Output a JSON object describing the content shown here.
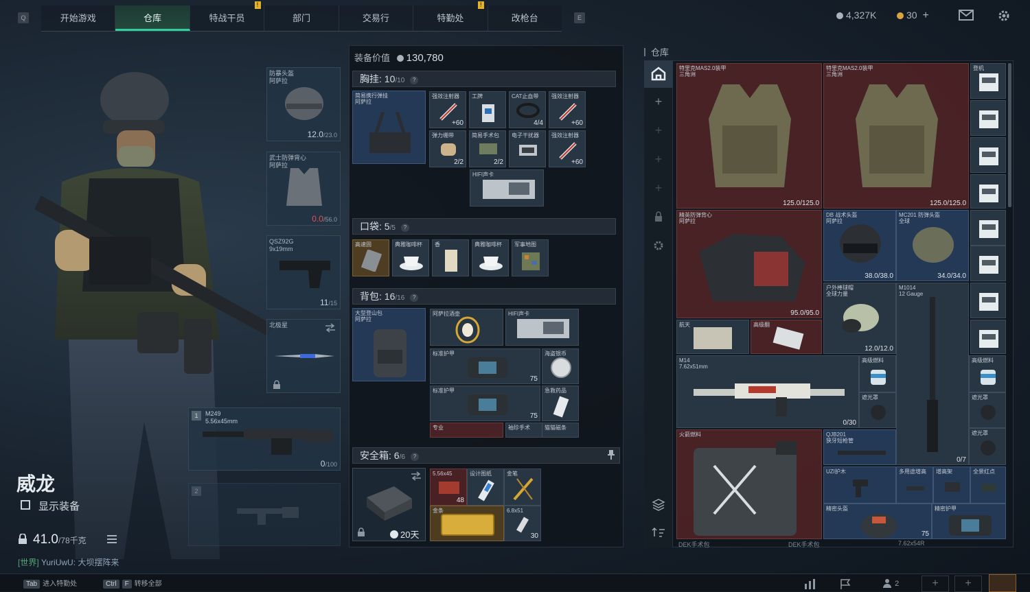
{
  "nav": {
    "left_key": "Q",
    "right_key": "E",
    "tabs": [
      {
        "label": "开始游戏",
        "warn": false
      },
      {
        "label": "仓库",
        "warn": false,
        "active": true
      },
      {
        "label": "特战干员",
        "warn": true
      },
      {
        "label": "部门",
        "warn": false
      },
      {
        "label": "交易行",
        "warn": false
      },
      {
        "label": "特勤处",
        "warn": true
      },
      {
        "label": "改枪台",
        "warn": false
      }
    ],
    "warn_glyph": "!"
  },
  "header_right": {
    "currency_main": "4,327K",
    "currency_secondary": "30",
    "add": "+",
    "coin_colors": {
      "main": "#aab2bb",
      "secondary": "#d8a441"
    }
  },
  "operator": {
    "name": "威龙",
    "show_equipment": "显示装备",
    "weight": "41.0",
    "weight_max": "/78千克",
    "chat_channel": "[世界]",
    "chat_text": "YuriUwU: 大坝摆阵来"
  },
  "equip_slots": {
    "helmet": {
      "name": "防暴头盔",
      "sub": "阿萨拉",
      "value": "12.0",
      "max": "/23.0"
    },
    "armor": {
      "name": "武士防弹背心",
      "sub": "阿萨拉",
      "value": "0.0",
      "max": "/56.0"
    },
    "pistol": {
      "name": "QSZ92G",
      "sub": "9x19mm",
      "value": "11",
      "max": "/15"
    },
    "melee": {
      "name": "北极星"
    },
    "primary1": {
      "index": "1",
      "name": "M249",
      "sub": "5.56x45mm",
      "value": "0",
      "max": "/100"
    },
    "primary2": {
      "index": "2"
    }
  },
  "loadout": {
    "value_label": "装备价值",
    "value": "130,780",
    "chest": {
      "label": "胸挂:",
      "count": "10",
      "max": "/10"
    },
    "pocket": {
      "label": "口袋:",
      "count": "5",
      "max": "/5"
    },
    "backpack": {
      "label": "背包:",
      "count": "16",
      "max": "/16"
    },
    "safebox": {
      "label": "安全箱:",
      "count": "6",
      "max": "/6",
      "timer": "20天"
    },
    "help": "?"
  },
  "chest_items": [
    {
      "t": "简易携行弹挂",
      "s": "阿萨拉"
    },
    {
      "t": "强效注射器",
      "n": "+60"
    },
    {
      "t": "工牌"
    },
    {
      "t": "CAT止血带",
      "n": "4/4"
    },
    {
      "t": "强效注射器",
      "n": "+60"
    },
    {
      "t": "弹力绷带",
      "n": "2/2"
    },
    {
      "t": "简易手术包",
      "n": "2/2"
    },
    {
      "t": "电子干扰器"
    },
    {
      "t": "强效注射器",
      "n": "+60"
    },
    {
      "t": "HIFI声卡"
    }
  ],
  "pocket_items": [
    {
      "t": "高速固"
    },
    {
      "t": "典雅咖啡杯"
    },
    {
      "t": "香"
    },
    {
      "t": "典雅咖啡杯"
    },
    {
      "t": "军事地图"
    }
  ],
  "backpack_items": [
    {
      "t": "大型登山包",
      "s": "阿萨拉"
    },
    {
      "t": "阿萨拉酒壶"
    },
    {
      "t": "HIFI声卡"
    },
    {
      "t": "标准护甲",
      "n": "75"
    },
    {
      "t": "海盗银币"
    },
    {
      "t": "标准护甲",
      "n": "75"
    },
    {
      "t": "急救药品"
    },
    {
      "t": "专业"
    },
    {
      "t": "袖珍手术"
    },
    {
      "t": "猫猫磁条"
    }
  ],
  "safebox_items": [
    {
      "t": "5.56x45",
      "n": "48"
    },
    {
      "t": "设计图纸"
    },
    {
      "t": "金笔"
    },
    {
      "t": "金条"
    },
    {
      "t": "6.8x51",
      "n": "30"
    }
  ],
  "stash": {
    "title": "仓库",
    "items": [
      {
        "t": "特里克MAS2.0装甲",
        "s": "三角洲",
        "n": "125.0/125.0"
      },
      {
        "t": "特里克MAS2.0装甲",
        "s": "三角洲",
        "n": "125.0/125.0"
      },
      {
        "t": "精英防弹背心",
        "s": "阿萨拉",
        "n": "95.0/95.0"
      },
      {
        "t": "DB 战术头盔",
        "s": "阿萨拉",
        "n": "38.0/38.0"
      },
      {
        "t": "MC201 防弹头盔",
        "s": "全球",
        "n": "34.0/34.0"
      },
      {
        "t": "户外棒球帽",
        "s": "全球力量",
        "n": "12.0/12.0"
      },
      {
        "t": "M1014",
        "s": "12 Gauge",
        "n": "0/7"
      },
      {
        "t": "航天"
      },
      {
        "t": "高级翻"
      },
      {
        "t": "M14",
        "s": "7.62x51mm",
        "n": "0/30"
      },
      {
        "t": "高级燃料"
      },
      {
        "t": "遮光罩"
      },
      {
        "t": "高级燃料"
      },
      {
        "t": "遮光罩"
      },
      {
        "t": "遮光罩"
      },
      {
        "t": "火箭燃料"
      },
      {
        "t": "QJB201",
        "s": "狭牙短枪管"
      },
      {
        "t": "UZI护木"
      },
      {
        "t": "多用途增高"
      },
      {
        "t": "增高架"
      },
      {
        "t": "全景红点"
      },
      {
        "t": "精密头盔"
      },
      {
        "t": "精密护甲",
        "n": "75"
      },
      {
        "t": "DEK手术包"
      },
      {
        "t": "DEK手术包"
      },
      {
        "t": "7.62x54R"
      },
      {
        "t": "登机"
      }
    ]
  },
  "bottom_bar": {
    "key1": "Tab",
    "action1": "进入特勤处",
    "key2": "Ctrl",
    "key2b": "F",
    "action2": "转移全部",
    "count": "2"
  }
}
